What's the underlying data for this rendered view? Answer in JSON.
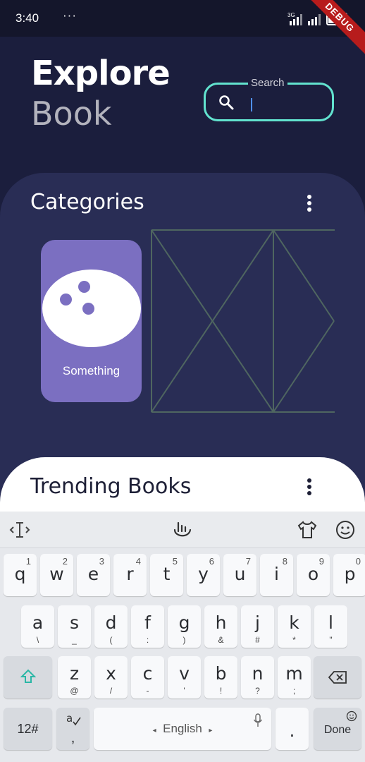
{
  "status_bar": {
    "time": "3:40",
    "dots": "···",
    "net_type": "3G",
    "debug": "DEBUG"
  },
  "header": {
    "title_line1": "Explore",
    "title_line2": "Book"
  },
  "search": {
    "label": "Search",
    "value": ""
  },
  "categories": {
    "title": "Categories",
    "items": [
      {
        "label": "Something",
        "icon": "bowling-ball-icon"
      }
    ]
  },
  "trending": {
    "title": "Trending Books"
  },
  "keyboard": {
    "row1": [
      {
        "k": "q",
        "n": "1"
      },
      {
        "k": "w",
        "n": "2"
      },
      {
        "k": "e",
        "n": "3"
      },
      {
        "k": "r",
        "n": "4"
      },
      {
        "k": "t",
        "n": "5"
      },
      {
        "k": "y",
        "n": "6"
      },
      {
        "k": "u",
        "n": "7"
      },
      {
        "k": "i",
        "n": "8"
      },
      {
        "k": "o",
        "n": "9"
      },
      {
        "k": "p",
        "n": "0"
      }
    ],
    "row2": [
      {
        "k": "a",
        "s": "\\"
      },
      {
        "k": "s",
        "s": "_"
      },
      {
        "k": "d",
        "s": "("
      },
      {
        "k": "f",
        "s": ":"
      },
      {
        "k": "g",
        "s": ")"
      },
      {
        "k": "h",
        "s": "&"
      },
      {
        "k": "j",
        "s": "#"
      },
      {
        "k": "k",
        "s": "*"
      },
      {
        "k": "l",
        "s": "\""
      }
    ],
    "row3": [
      {
        "k": "z",
        "s": "@"
      },
      {
        "k": "x",
        "s": "/"
      },
      {
        "k": "c",
        "s": "-"
      },
      {
        "k": "v",
        "s": "'"
      },
      {
        "k": "b",
        "s": "!"
      },
      {
        "k": "n",
        "s": "?"
      },
      {
        "k": "m",
        "s": ";"
      }
    ],
    "symbols_label": "12#",
    "space_label": "English",
    "period_label": ".",
    "done_label": "Done",
    "comma_label": ","
  }
}
